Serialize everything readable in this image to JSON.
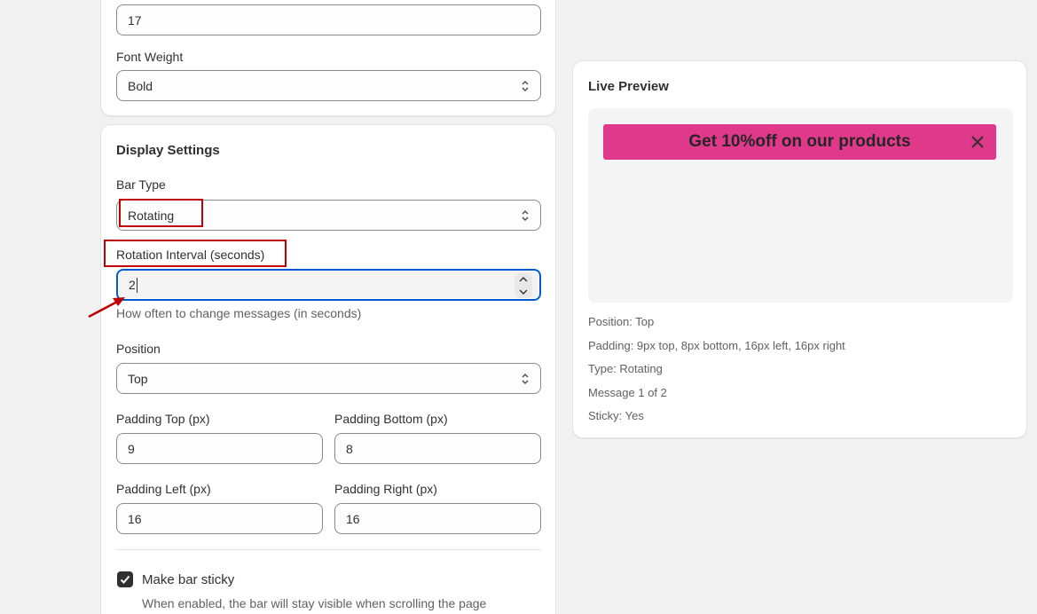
{
  "settings": {
    "font_size_value": "17",
    "font_weight_label": "Font Weight",
    "font_weight_value": "Bold"
  },
  "display": {
    "heading": "Display Settings",
    "bar_type_label": "Bar Type",
    "bar_type_value": "Rotating",
    "rotation_label": "Rotation Interval (seconds)",
    "rotation_value": "2",
    "rotation_help": "How often to change messages (in seconds)",
    "position_label": "Position",
    "position_value": "Top",
    "padding_top_label": "Padding Top (px)",
    "padding_top_value": "9",
    "padding_bottom_label": "Padding Bottom (px)",
    "padding_bottom_value": "8",
    "padding_left_label": "Padding Left (px)",
    "padding_left_value": "16",
    "padding_right_label": "Padding Right (px)",
    "padding_right_value": "16",
    "sticky_label": "Make bar sticky",
    "sticky_checked": true,
    "sticky_help": "When enabled, the bar will stay visible when scrolling the page"
  },
  "preview": {
    "heading": "Live Preview",
    "bar_text": "Get 10%off on our products",
    "bar_color": "#e0388a",
    "meta": [
      "Position: Top",
      "Padding: 9px top, 8px bottom, 16px left, 16px right",
      "Type: Rotating",
      "Message 1 of 2",
      "Sticky: Yes"
    ]
  },
  "colors": {
    "annotation": "#c00000",
    "focus_ring": "#005bd3"
  }
}
